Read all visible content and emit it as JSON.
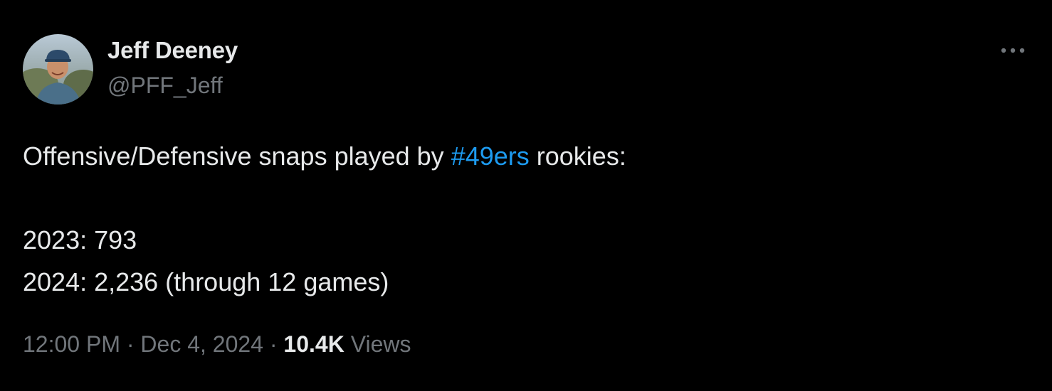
{
  "author": {
    "display_name": "Jeff Deeney",
    "handle": "@PFF_Jeff",
    "avatar_icon": "user-avatar-photo"
  },
  "more_icon": "more-options-icon",
  "tweet": {
    "text_before_hashtag": "Offensive/Defensive snaps played by ",
    "hashtag": "#49ers",
    "text_after_hashtag": " rookies:",
    "line_2023": "2023: 793",
    "line_2024": "2024: 2,236 (through 12 games)"
  },
  "meta": {
    "time": "12:00 PM",
    "separator": " · ",
    "date": "Dec 4, 2024",
    "views_count": "10.4K",
    "views_label": " Views"
  },
  "colors": {
    "background": "#000000",
    "text": "#e7e9ea",
    "secondary": "#71767b",
    "link": "#1d9bf0"
  }
}
